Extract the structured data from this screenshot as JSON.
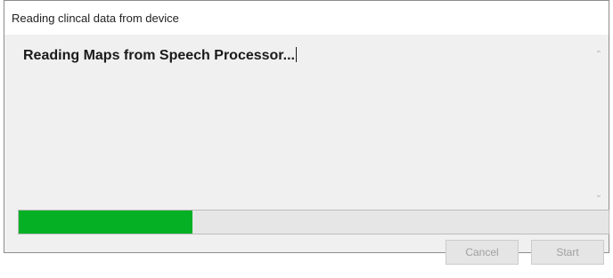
{
  "window": {
    "title": "Reading clincal data from device"
  },
  "message": {
    "text": "Reading Maps from Speech Processor..."
  },
  "progress": {
    "percent": 29.5,
    "color": "#06b025"
  },
  "buttons": {
    "cancel_label": "Cancel",
    "start_label": "Start"
  },
  "icons": {
    "scroll_up": "chevron-up-icon",
    "scroll_down": "chevron-down-icon"
  }
}
